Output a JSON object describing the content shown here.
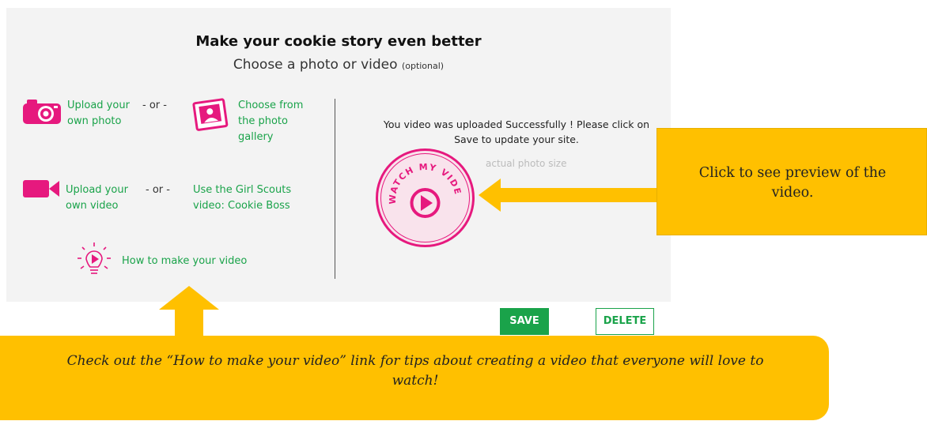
{
  "header": {
    "title": "Make your cookie story even better",
    "subtitle": "Choose a photo or video",
    "optional": "(optional)"
  },
  "options": {
    "upload_photo": [
      "Upload your",
      "own photo"
    ],
    "or1": "- or -",
    "photo_gallery": [
      "Choose from",
      "the photo",
      "gallery"
    ],
    "upload_video": [
      "Upload your",
      "own video"
    ],
    "or2": "- or -",
    "gs_video": [
      "Use the Girl Scouts",
      "video: Cookie Boss"
    ],
    "how_to": "How to make your video"
  },
  "preview": {
    "message": [
      "You video was uploaded Successfully ! Please click on",
      "Save to update your site."
    ],
    "actual_size": "actual photo size",
    "watch_label": "WATCH MY VIDEO"
  },
  "buttons": {
    "save": "SAVE",
    "delete": "DELETE"
  },
  "callouts": {
    "right": [
      "Click to see preview  of the",
      "video."
    ],
    "bottom": [
      "Check out the “How to make your video” link for tips about creating a video that  everyone will love to",
      "watch!"
    ]
  },
  "colors": {
    "accent_green": "#1aa34a",
    "accent_pink": "#e6197e",
    "callout_yellow": "#ffc000",
    "panel_bg": "#f3f3f3"
  },
  "icons": [
    "camera-icon",
    "photo-gallery-icon",
    "video-camera-icon",
    "lightbulb-play-icon",
    "play-icon"
  ]
}
